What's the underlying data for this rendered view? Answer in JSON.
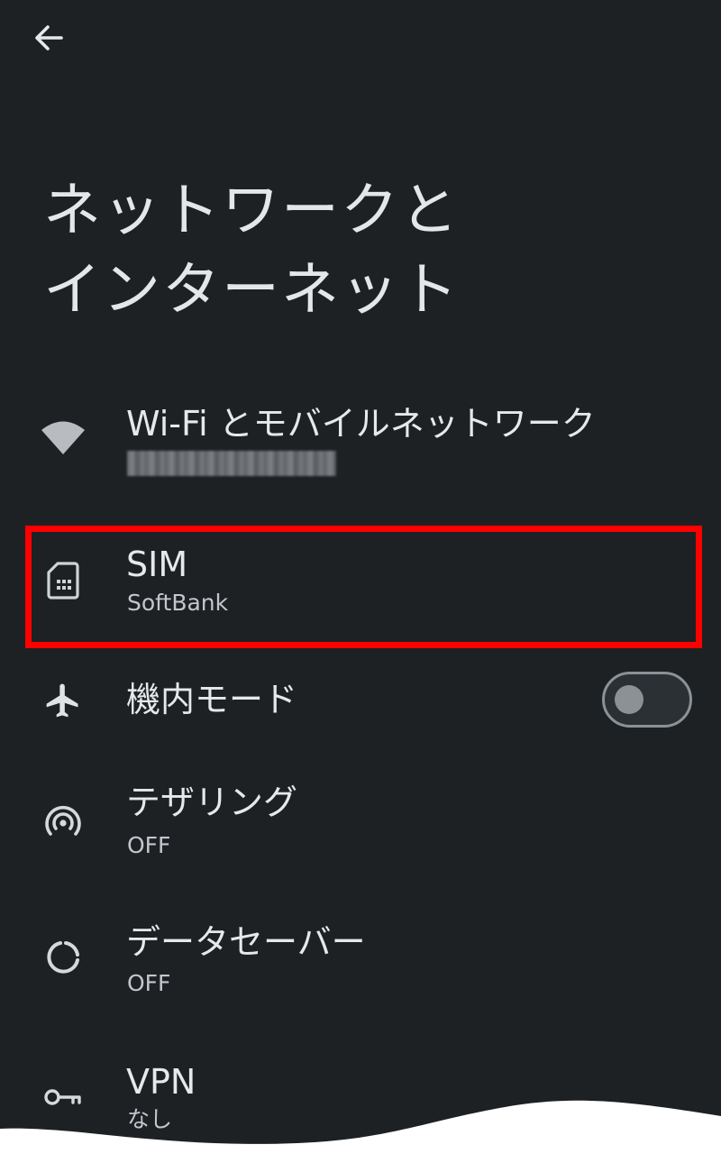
{
  "header": {
    "back_icon": "arrow-back-icon",
    "title_line1": "ネットワークと",
    "title_line2": "インターネット"
  },
  "settings": {
    "wifi": {
      "icon": "wifi-icon",
      "title": "Wi-Fi とモバイルネットワーク",
      "subtitle": ""
    },
    "sim": {
      "icon": "sim-card-icon",
      "title": "SIM",
      "subtitle": "SoftBank"
    },
    "airplane": {
      "icon": "airplane-icon",
      "title": "機内モード",
      "toggle_state": "off"
    },
    "tethering": {
      "icon": "hotspot-icon",
      "title": "テザリング",
      "subtitle": "OFF"
    },
    "data_saver": {
      "icon": "data-saver-icon",
      "title": "データセーバー",
      "subtitle": "OFF"
    },
    "vpn": {
      "icon": "vpn-key-icon",
      "title": "VPN",
      "subtitle": "なし"
    }
  },
  "colors": {
    "background": "#1d2124",
    "text_primary": "#e6e8eb",
    "text_secondary": "#c3c7cc",
    "highlight": "#ff0000",
    "toggle": "#8c9196"
  }
}
